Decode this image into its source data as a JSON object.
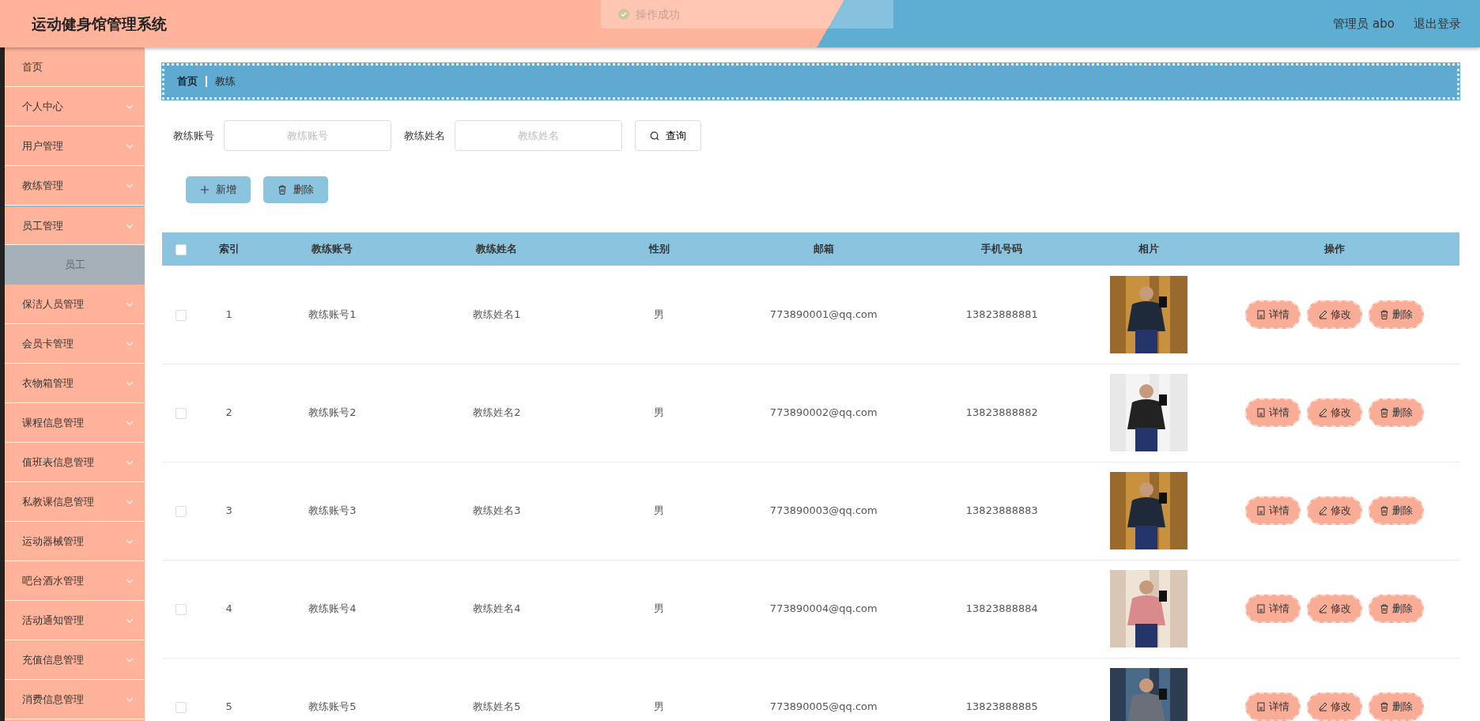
{
  "header": {
    "title": "运动健身馆管理系统",
    "user": "管理员 abo",
    "logout": "退出登录"
  },
  "toast": {
    "message": "操作成功"
  },
  "sidebar": {
    "items": [
      {
        "label": "首页",
        "kind": "link"
      },
      {
        "label": "个人中心",
        "kind": "submenu",
        "expanded": false
      },
      {
        "label": "用户管理",
        "kind": "submenu",
        "expanded": false
      },
      {
        "label": "教练管理",
        "kind": "submenu",
        "expanded": false
      },
      {
        "label": "员工管理",
        "kind": "submenu",
        "expanded": true,
        "children": [
          {
            "label": "员工",
            "selected": true
          }
        ]
      },
      {
        "label": "保洁人员管理",
        "kind": "submenu",
        "expanded": false
      },
      {
        "label": "会员卡管理",
        "kind": "submenu",
        "expanded": false
      },
      {
        "label": "衣物箱管理",
        "kind": "submenu",
        "expanded": false
      },
      {
        "label": "课程信息管理",
        "kind": "submenu",
        "expanded": false
      },
      {
        "label": "值班表信息管理",
        "kind": "submenu",
        "expanded": false
      },
      {
        "label": "私教课信息管理",
        "kind": "submenu",
        "expanded": false
      },
      {
        "label": "运动器械管理",
        "kind": "submenu",
        "expanded": false
      },
      {
        "label": "吧台酒水管理",
        "kind": "submenu",
        "expanded": false
      },
      {
        "label": "活动通知管理",
        "kind": "submenu",
        "expanded": false
      },
      {
        "label": "充值信息管理",
        "kind": "submenu",
        "expanded": false
      },
      {
        "label": "消费信息管理",
        "kind": "submenu",
        "expanded": false
      }
    ]
  },
  "breadcrumb": [
    "首页",
    "教练"
  ],
  "search": {
    "fields": [
      {
        "label": "教练账号",
        "placeholder": "教练账号"
      },
      {
        "label": "教练姓名",
        "placeholder": "教练姓名"
      }
    ],
    "button": "查询"
  },
  "actions": [
    {
      "label": "新增",
      "kind": "add"
    },
    {
      "label": "删除",
      "kind": "delete"
    }
  ],
  "table": {
    "select_all_checked": false,
    "columns": [
      "索引",
      "教练账号",
      "教练姓名",
      "性别",
      "邮箱",
      "手机号码",
      "相片",
      "操作"
    ],
    "rows": [
      {
        "checked": false,
        "index": "1",
        "account": "教练账号1",
        "name": "教练姓名1",
        "gender": "男",
        "email": "773890001@qq.com",
        "phone": "13823888881",
        "operations": [
          "详情",
          "修改",
          "删除"
        ]
      },
      {
        "checked": false,
        "index": "2",
        "account": "教练账号2",
        "name": "教练姓名2",
        "gender": "男",
        "email": "773890002@qq.com",
        "phone": "13823888882",
        "operations": [
          "详情",
          "修改",
          "删除"
        ]
      },
      {
        "checked": false,
        "index": "3",
        "account": "教练账号3",
        "name": "教练姓名3",
        "gender": "男",
        "email": "773890003@qq.com",
        "phone": "13823888883",
        "operations": [
          "详情",
          "修改",
          "删除"
        ]
      },
      {
        "checked": false,
        "index": "4",
        "account": "教练账号4",
        "name": "教练姓名4",
        "gender": "男",
        "email": "773890004@qq.com",
        "phone": "13823888884",
        "operations": [
          "详情",
          "修改",
          "删除"
        ]
      },
      {
        "checked": false,
        "index": "5",
        "account": "教练账号5",
        "name": "教练姓名5",
        "gender": "男",
        "email": "773890005@qq.com",
        "phone": "13823888885",
        "operations": [
          "详情",
          "修改",
          "删除"
        ]
      }
    ]
  }
}
